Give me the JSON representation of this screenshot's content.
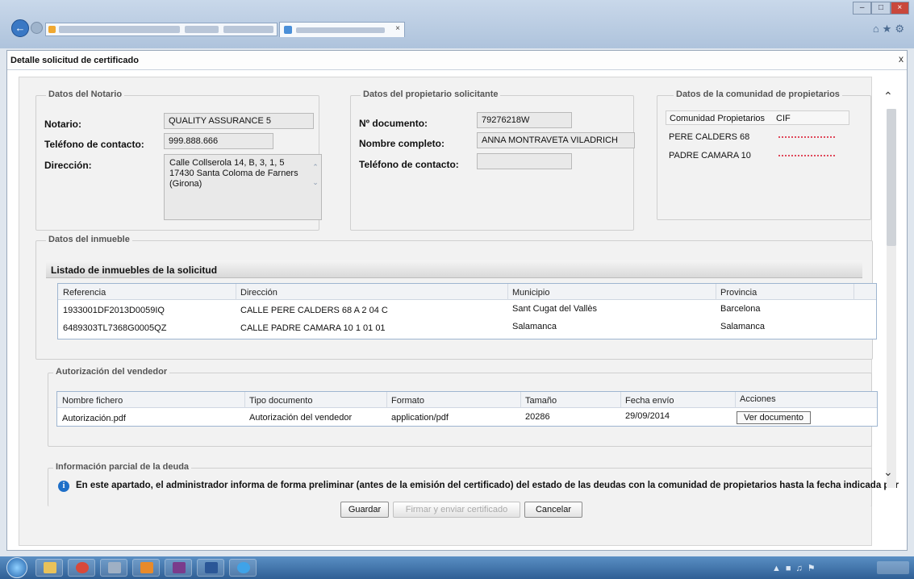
{
  "dialog": {
    "title": "Detalle solicitud de certificado",
    "close_label": "x"
  },
  "notario": {
    "legend": "Datos del Notario",
    "notario_label": "Notario:",
    "notario_value": "QUALITY ASSURANCE 5",
    "telefono_label": "Teléfono de contacto:",
    "telefono_value": "999.888.666",
    "direccion_label": "Dirección:",
    "direccion_line1": "Calle Collserola 14, B, 3, 1, 5",
    "direccion_line2": "17430 Santa Coloma de Farners",
    "direccion_line3": "(Girona)"
  },
  "propietario": {
    "legend": "Datos del propietario solicitante",
    "documento_label": "Nº documento:",
    "documento_value": "79276218W",
    "nombre_label": "Nombre completo:",
    "nombre_value": "ANNA MONTRAVETA VILADRICH",
    "telefono_label": "Teléfono de contacto:",
    "telefono_value": ""
  },
  "comunidad": {
    "legend": "Datos de la comunidad de propietarios",
    "col_comunidad": "Comunidad Propietarios",
    "col_cif": "CIF",
    "rows": [
      {
        "nombre": "PERE CALDERS 68"
      },
      {
        "nombre": "PADRE CAMARA 10"
      }
    ]
  },
  "inmueble": {
    "legend": "Datos del inmueble",
    "table_title": "Listado de inmuebles de la solicitud",
    "headers": [
      "Referencia",
      "Dirección",
      "Municipio",
      "Provincia"
    ],
    "rows": [
      [
        "1933001DF2013D0059IQ",
        "CALLE PERE CALDERS 68 A 2 04 C",
        "Sant Cugat del Vallès",
        "Barcelona"
      ],
      [
        "6489303TL7368G0005QZ",
        "CALLE PADRE CAMARA 10 1 01 01",
        "Salamanca",
        "Salamanca"
      ]
    ]
  },
  "vendedor": {
    "legend": "Autorización del vendedor",
    "headers": [
      "Nombre fichero",
      "Tipo documento",
      "Formato",
      "Tamaño",
      "Fecha envío",
      "Acciones"
    ],
    "row": [
      "Autorización.pdf",
      "Autorización del vendedor",
      "application/pdf",
      "20286",
      "29/09/2014"
    ],
    "ver_documento": "Ver documento"
  },
  "deuda": {
    "legend": "Información parcial de la deuda",
    "info_text": "En este apartado, el administrador informa de forma preliminar (antes de la emisión del certificado) del estado de las deudas con la comunidad de propietarios hasta la fecha indicada por"
  },
  "actions": {
    "guardar": "Guardar",
    "firmar": "Firmar y enviar certificado",
    "cancelar": "Cancelar"
  },
  "icons": {
    "back": "back-arrow-icon",
    "info": "info-icon",
    "scroll_up": "chevron-up-icon",
    "scroll_down": "chevron-down-icon"
  },
  "colors": {
    "accent": "#1e6fc8",
    "panel": "#f2f2f2",
    "taskbar": "#2f5f95",
    "cif_scribble": "#e0485a"
  }
}
